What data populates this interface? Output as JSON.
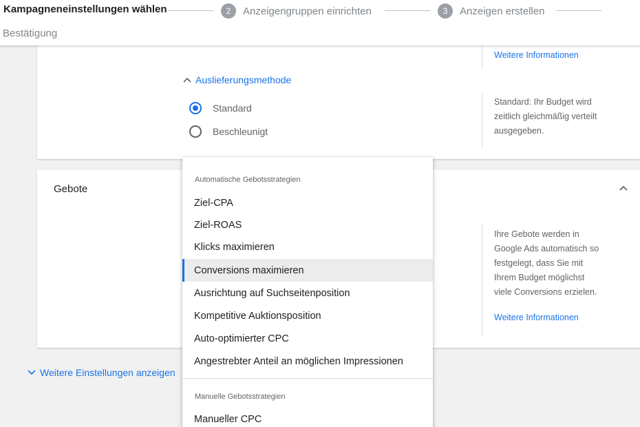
{
  "stepper": {
    "steps": [
      {
        "label": "Kampagneneinstellungen wählen"
      },
      {
        "number": "2",
        "label": "Anzeigengruppen einrichten"
      },
      {
        "number": "3",
        "label": "Anzeigen erstellen"
      },
      {
        "label": "Bestätigung"
      }
    ]
  },
  "budget_card": {
    "help_link": "Weitere Informationen",
    "delivery_toggle": "Auslieferungsmethode",
    "options": [
      {
        "label": "Standard",
        "checked": true
      },
      {
        "label": "Beschleunigt",
        "checked": false
      }
    ],
    "delivery_help": [
      "Standard: Ihr Budget wird",
      "zeitlich gleichmäßig verteilt",
      "ausgegeben."
    ]
  },
  "bids_card": {
    "title": "Gebote",
    "help": [
      "Ihre Gebote werden in",
      "Google Ads automatisch so",
      "festgelegt, dass Sie mit",
      "Ihrem Budget möglichst",
      "viele Conversions erzielen."
    ],
    "help_link": "Weitere Informationen"
  },
  "more_settings": "Weitere Einstellungen anzeigen",
  "menu": {
    "auto_header": "Automatische Gebotsstrategien",
    "auto_items": [
      "Ziel-CPA",
      "Ziel-ROAS",
      "Klicks maximieren",
      "Conversions maximieren",
      "Ausrichtung auf Suchseitenposition",
      "Kompetitive Auktionsposition",
      "Auto-optimierter CPC",
      "Angestrebter Anteil an möglichen Impressionen"
    ],
    "selected": "Conversions maximieren",
    "manual_header": "Manuelle Gebotsstrategien",
    "manual_items": [
      "Manueller CPC"
    ]
  },
  "colors": {
    "accent": "#1a73e8",
    "muted": "#5f6368",
    "step_badge": "#9aa0a6"
  }
}
